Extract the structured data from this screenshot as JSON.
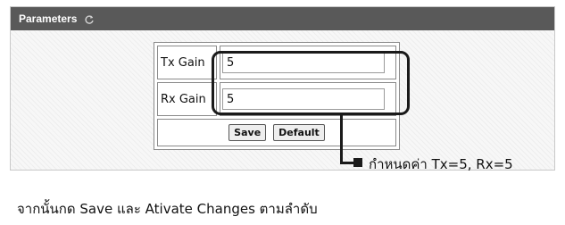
{
  "panel": {
    "title": "Parameters",
    "refresh_icon": "refresh-icon"
  },
  "params": {
    "tx_gain": {
      "label": "Tx Gain",
      "value": "5"
    },
    "rx_gain": {
      "label": "Rx Gain",
      "value": "5"
    }
  },
  "buttons": {
    "save_label": "Save",
    "default_label": "Default"
  },
  "annotation": {
    "callout_text": "กำหนดค่า Tx=5, Rx=5",
    "instruction_text": "จากนั้นกด Save และ Ativate Changes ตามลำดับ"
  },
  "colors": {
    "header_bg": "#595959",
    "header_text": "#ffffff",
    "callout_stroke": "#1a1a1a"
  }
}
